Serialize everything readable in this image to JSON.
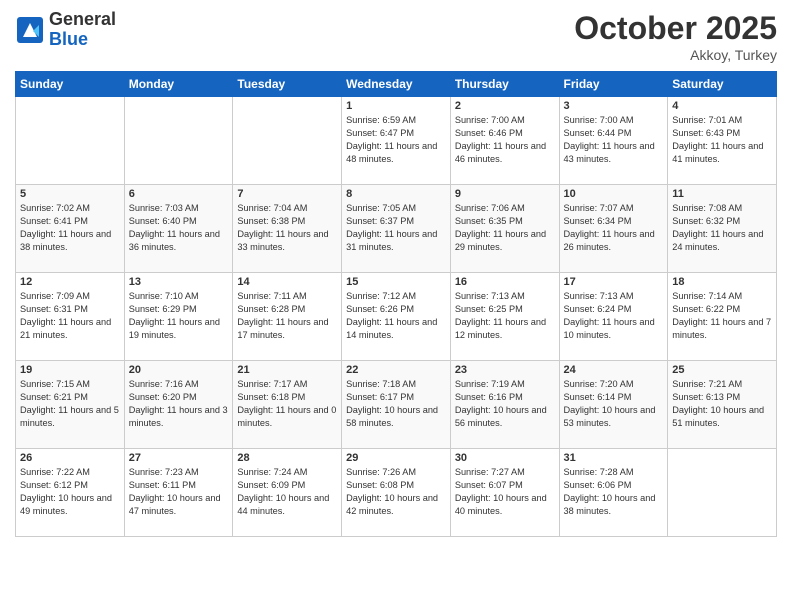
{
  "header": {
    "logo_general": "General",
    "logo_blue": "Blue",
    "month": "October 2025",
    "location": "Akkoy, Turkey"
  },
  "days_of_week": [
    "Sunday",
    "Monday",
    "Tuesday",
    "Wednesday",
    "Thursday",
    "Friday",
    "Saturday"
  ],
  "weeks": [
    {
      "cells": [
        {
          "day": "",
          "empty": true
        },
        {
          "day": "",
          "empty": true
        },
        {
          "day": "",
          "empty": true
        },
        {
          "day": "1",
          "sunrise": "Sunrise: 6:59 AM",
          "sunset": "Sunset: 6:47 PM",
          "daylight": "Daylight: 11 hours and 48 minutes."
        },
        {
          "day": "2",
          "sunrise": "Sunrise: 7:00 AM",
          "sunset": "Sunset: 6:46 PM",
          "daylight": "Daylight: 11 hours and 46 minutes."
        },
        {
          "day": "3",
          "sunrise": "Sunrise: 7:00 AM",
          "sunset": "Sunset: 6:44 PM",
          "daylight": "Daylight: 11 hours and 43 minutes."
        },
        {
          "day": "4",
          "sunrise": "Sunrise: 7:01 AM",
          "sunset": "Sunset: 6:43 PM",
          "daylight": "Daylight: 11 hours and 41 minutes."
        }
      ]
    },
    {
      "cells": [
        {
          "day": "5",
          "sunrise": "Sunrise: 7:02 AM",
          "sunset": "Sunset: 6:41 PM",
          "daylight": "Daylight: 11 hours and 38 minutes."
        },
        {
          "day": "6",
          "sunrise": "Sunrise: 7:03 AM",
          "sunset": "Sunset: 6:40 PM",
          "daylight": "Daylight: 11 hours and 36 minutes."
        },
        {
          "day": "7",
          "sunrise": "Sunrise: 7:04 AM",
          "sunset": "Sunset: 6:38 PM",
          "daylight": "Daylight: 11 hours and 33 minutes."
        },
        {
          "day": "8",
          "sunrise": "Sunrise: 7:05 AM",
          "sunset": "Sunset: 6:37 PM",
          "daylight": "Daylight: 11 hours and 31 minutes."
        },
        {
          "day": "9",
          "sunrise": "Sunrise: 7:06 AM",
          "sunset": "Sunset: 6:35 PM",
          "daylight": "Daylight: 11 hours and 29 minutes."
        },
        {
          "day": "10",
          "sunrise": "Sunrise: 7:07 AM",
          "sunset": "Sunset: 6:34 PM",
          "daylight": "Daylight: 11 hours and 26 minutes."
        },
        {
          "day": "11",
          "sunrise": "Sunrise: 7:08 AM",
          "sunset": "Sunset: 6:32 PM",
          "daylight": "Daylight: 11 hours and 24 minutes."
        }
      ]
    },
    {
      "cells": [
        {
          "day": "12",
          "sunrise": "Sunrise: 7:09 AM",
          "sunset": "Sunset: 6:31 PM",
          "daylight": "Daylight: 11 hours and 21 minutes."
        },
        {
          "day": "13",
          "sunrise": "Sunrise: 7:10 AM",
          "sunset": "Sunset: 6:29 PM",
          "daylight": "Daylight: 11 hours and 19 minutes."
        },
        {
          "day": "14",
          "sunrise": "Sunrise: 7:11 AM",
          "sunset": "Sunset: 6:28 PM",
          "daylight": "Daylight: 11 hours and 17 minutes."
        },
        {
          "day": "15",
          "sunrise": "Sunrise: 7:12 AM",
          "sunset": "Sunset: 6:26 PM",
          "daylight": "Daylight: 11 hours and 14 minutes."
        },
        {
          "day": "16",
          "sunrise": "Sunrise: 7:13 AM",
          "sunset": "Sunset: 6:25 PM",
          "daylight": "Daylight: 11 hours and 12 minutes."
        },
        {
          "day": "17",
          "sunrise": "Sunrise: 7:13 AM",
          "sunset": "Sunset: 6:24 PM",
          "daylight": "Daylight: 11 hours and 10 minutes."
        },
        {
          "day": "18",
          "sunrise": "Sunrise: 7:14 AM",
          "sunset": "Sunset: 6:22 PM",
          "daylight": "Daylight: 11 hours and 7 minutes."
        }
      ]
    },
    {
      "cells": [
        {
          "day": "19",
          "sunrise": "Sunrise: 7:15 AM",
          "sunset": "Sunset: 6:21 PM",
          "daylight": "Daylight: 11 hours and 5 minutes."
        },
        {
          "day": "20",
          "sunrise": "Sunrise: 7:16 AM",
          "sunset": "Sunset: 6:20 PM",
          "daylight": "Daylight: 11 hours and 3 minutes."
        },
        {
          "day": "21",
          "sunrise": "Sunrise: 7:17 AM",
          "sunset": "Sunset: 6:18 PM",
          "daylight": "Daylight: 11 hours and 0 minutes."
        },
        {
          "day": "22",
          "sunrise": "Sunrise: 7:18 AM",
          "sunset": "Sunset: 6:17 PM",
          "daylight": "Daylight: 10 hours and 58 minutes."
        },
        {
          "day": "23",
          "sunrise": "Sunrise: 7:19 AM",
          "sunset": "Sunset: 6:16 PM",
          "daylight": "Daylight: 10 hours and 56 minutes."
        },
        {
          "day": "24",
          "sunrise": "Sunrise: 7:20 AM",
          "sunset": "Sunset: 6:14 PM",
          "daylight": "Daylight: 10 hours and 53 minutes."
        },
        {
          "day": "25",
          "sunrise": "Sunrise: 7:21 AM",
          "sunset": "Sunset: 6:13 PM",
          "daylight": "Daylight: 10 hours and 51 minutes."
        }
      ]
    },
    {
      "cells": [
        {
          "day": "26",
          "sunrise": "Sunrise: 7:22 AM",
          "sunset": "Sunset: 6:12 PM",
          "daylight": "Daylight: 10 hours and 49 minutes."
        },
        {
          "day": "27",
          "sunrise": "Sunrise: 7:23 AM",
          "sunset": "Sunset: 6:11 PM",
          "daylight": "Daylight: 10 hours and 47 minutes."
        },
        {
          "day": "28",
          "sunrise": "Sunrise: 7:24 AM",
          "sunset": "Sunset: 6:09 PM",
          "daylight": "Daylight: 10 hours and 44 minutes."
        },
        {
          "day": "29",
          "sunrise": "Sunrise: 7:26 AM",
          "sunset": "Sunset: 6:08 PM",
          "daylight": "Daylight: 10 hours and 42 minutes."
        },
        {
          "day": "30",
          "sunrise": "Sunrise: 7:27 AM",
          "sunset": "Sunset: 6:07 PM",
          "daylight": "Daylight: 10 hours and 40 minutes."
        },
        {
          "day": "31",
          "sunrise": "Sunrise: 7:28 AM",
          "sunset": "Sunset: 6:06 PM",
          "daylight": "Daylight: 10 hours and 38 minutes."
        },
        {
          "day": "",
          "empty": true
        }
      ]
    }
  ]
}
